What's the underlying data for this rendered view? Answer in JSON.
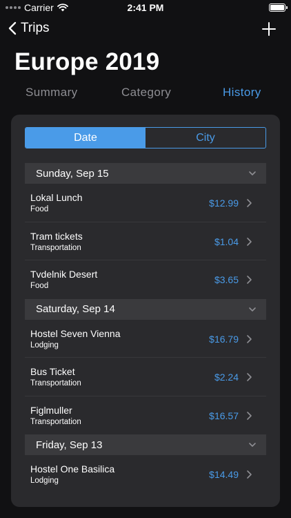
{
  "status": {
    "carrier": "Carrier",
    "time": "2:41 PM"
  },
  "nav": {
    "back_label": "Trips"
  },
  "page": {
    "title": "Europe 2019"
  },
  "tabs": [
    {
      "label": "Summary"
    },
    {
      "label": "Category"
    },
    {
      "label": "History"
    }
  ],
  "segments": [
    {
      "label": "Date"
    },
    {
      "label": "City"
    }
  ],
  "sections": [
    {
      "header": "Sunday, Sep 15",
      "items": [
        {
          "title": "Lokal Lunch",
          "category": "Food",
          "amount": "$12.99"
        },
        {
          "title": "Tram tickets",
          "category": "Transportation",
          "amount": "$1.04"
        },
        {
          "title": "Tvdelnik Desert",
          "category": "Food",
          "amount": "$3.65"
        }
      ]
    },
    {
      "header": "Saturday, Sep 14",
      "items": [
        {
          "title": "Hostel Seven Vienna",
          "category": "Lodging",
          "amount": "$16.79"
        },
        {
          "title": "Bus Ticket",
          "category": "Transportation",
          "amount": "$2.24"
        },
        {
          "title": "Figlmuller",
          "category": "Transportation",
          "amount": "$16.57"
        }
      ]
    },
    {
      "header": "Friday, Sep 13",
      "items": [
        {
          "title": "Hostel One Basilica",
          "category": "Lodging",
          "amount": "$14.49"
        }
      ]
    }
  ],
  "colors": {
    "accent": "#4a9be8",
    "background": "#111113",
    "card": "#2a2a2d",
    "section": "#3a3a3d"
  },
  "icons": {
    "back": "chevron-left-icon",
    "add": "plus-icon",
    "wifi": "wifi-icon",
    "battery": "battery-icon",
    "disclosure": "chevron-right-icon",
    "collapse": "chevron-down-icon"
  }
}
